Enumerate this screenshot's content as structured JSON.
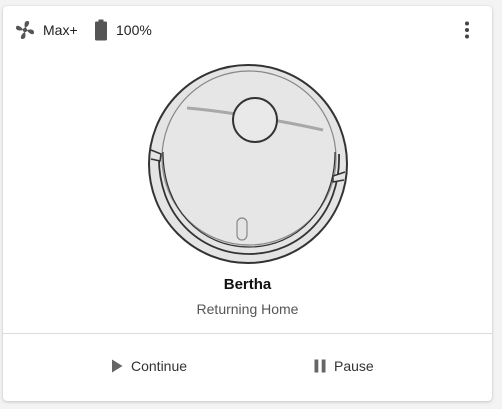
{
  "header": {
    "fan_speed": "Max+",
    "fan_icon": "fan-icon",
    "battery_level": "100%",
    "battery_icon": "battery-full-icon",
    "menu_icon": "more-vertical-icon"
  },
  "robot": {
    "name": "Bertha",
    "status": "Returning Home",
    "image": "robot-vacuum-illustration"
  },
  "actions": {
    "continue_label": "Continue",
    "continue_icon": "play-icon",
    "pause_label": "Pause",
    "pause_icon": "pause-icon"
  }
}
